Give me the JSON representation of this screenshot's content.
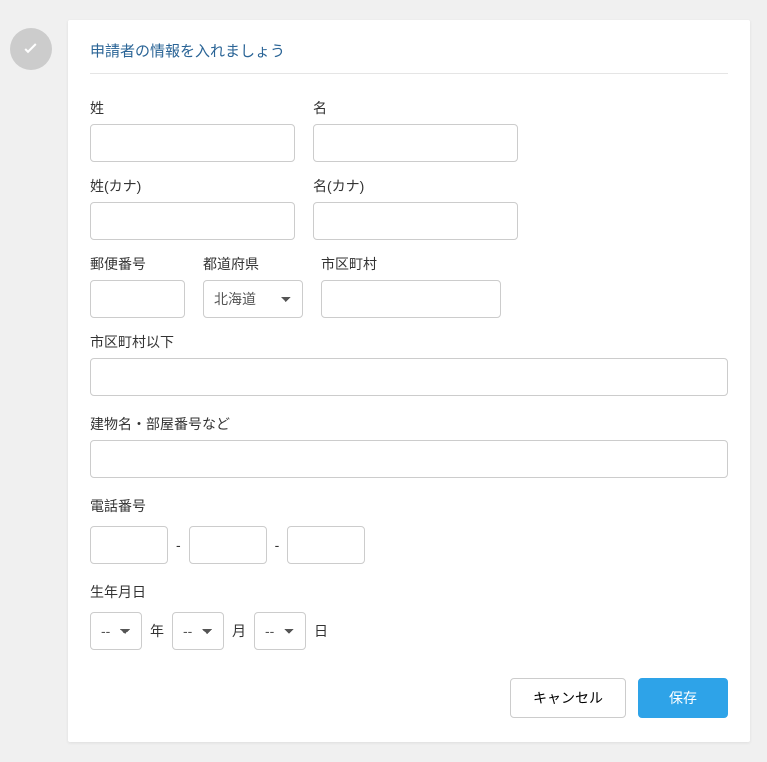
{
  "section_title": "申請者の情報を入れましょう",
  "labels": {
    "last_name": "姓",
    "first_name": "名",
    "last_name_kana": "姓(カナ)",
    "first_name_kana": "名(カナ)",
    "zip": "郵便番号",
    "prefecture": "都道府県",
    "city": "市区町村",
    "address_rest": "市区町村以下",
    "building": "建物名・部屋番号など",
    "phone": "電話番号",
    "dob": "生年月日"
  },
  "prefecture_selected": "北海道",
  "dob_placeholder": "--",
  "date_units": {
    "year": "年",
    "month": "月",
    "day": "日"
  },
  "phone_sep": "-",
  "buttons": {
    "cancel": "キャンセル",
    "save": "保存"
  }
}
